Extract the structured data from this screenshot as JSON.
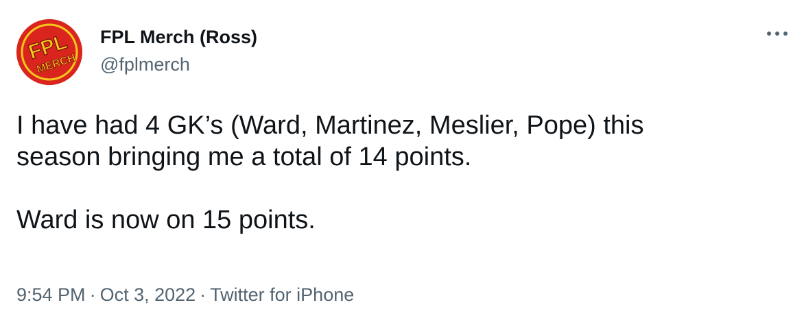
{
  "author": {
    "display_name": "FPL Merch (Ross)",
    "handle": "@fplmerch",
    "avatar_text": "FPL MERCH"
  },
  "tweet": {
    "lines": [
      "I have had 4 GK’s (Ward, Martinez, Meslier, Pope) this",
      "season bringing me a total of 14 points.",
      "Ward is now on 15 points."
    ]
  },
  "meta": {
    "time": "9:54 PM",
    "date": "Oct 3, 2022",
    "source": "Twitter for iPhone",
    "separator": "·"
  },
  "icons": {
    "more": "more-horizontal-icon"
  },
  "colors": {
    "text": "#0f1419",
    "secondary": "#536471",
    "avatar_red": "#d9251d",
    "avatar_yellow": "#f6c81e"
  }
}
